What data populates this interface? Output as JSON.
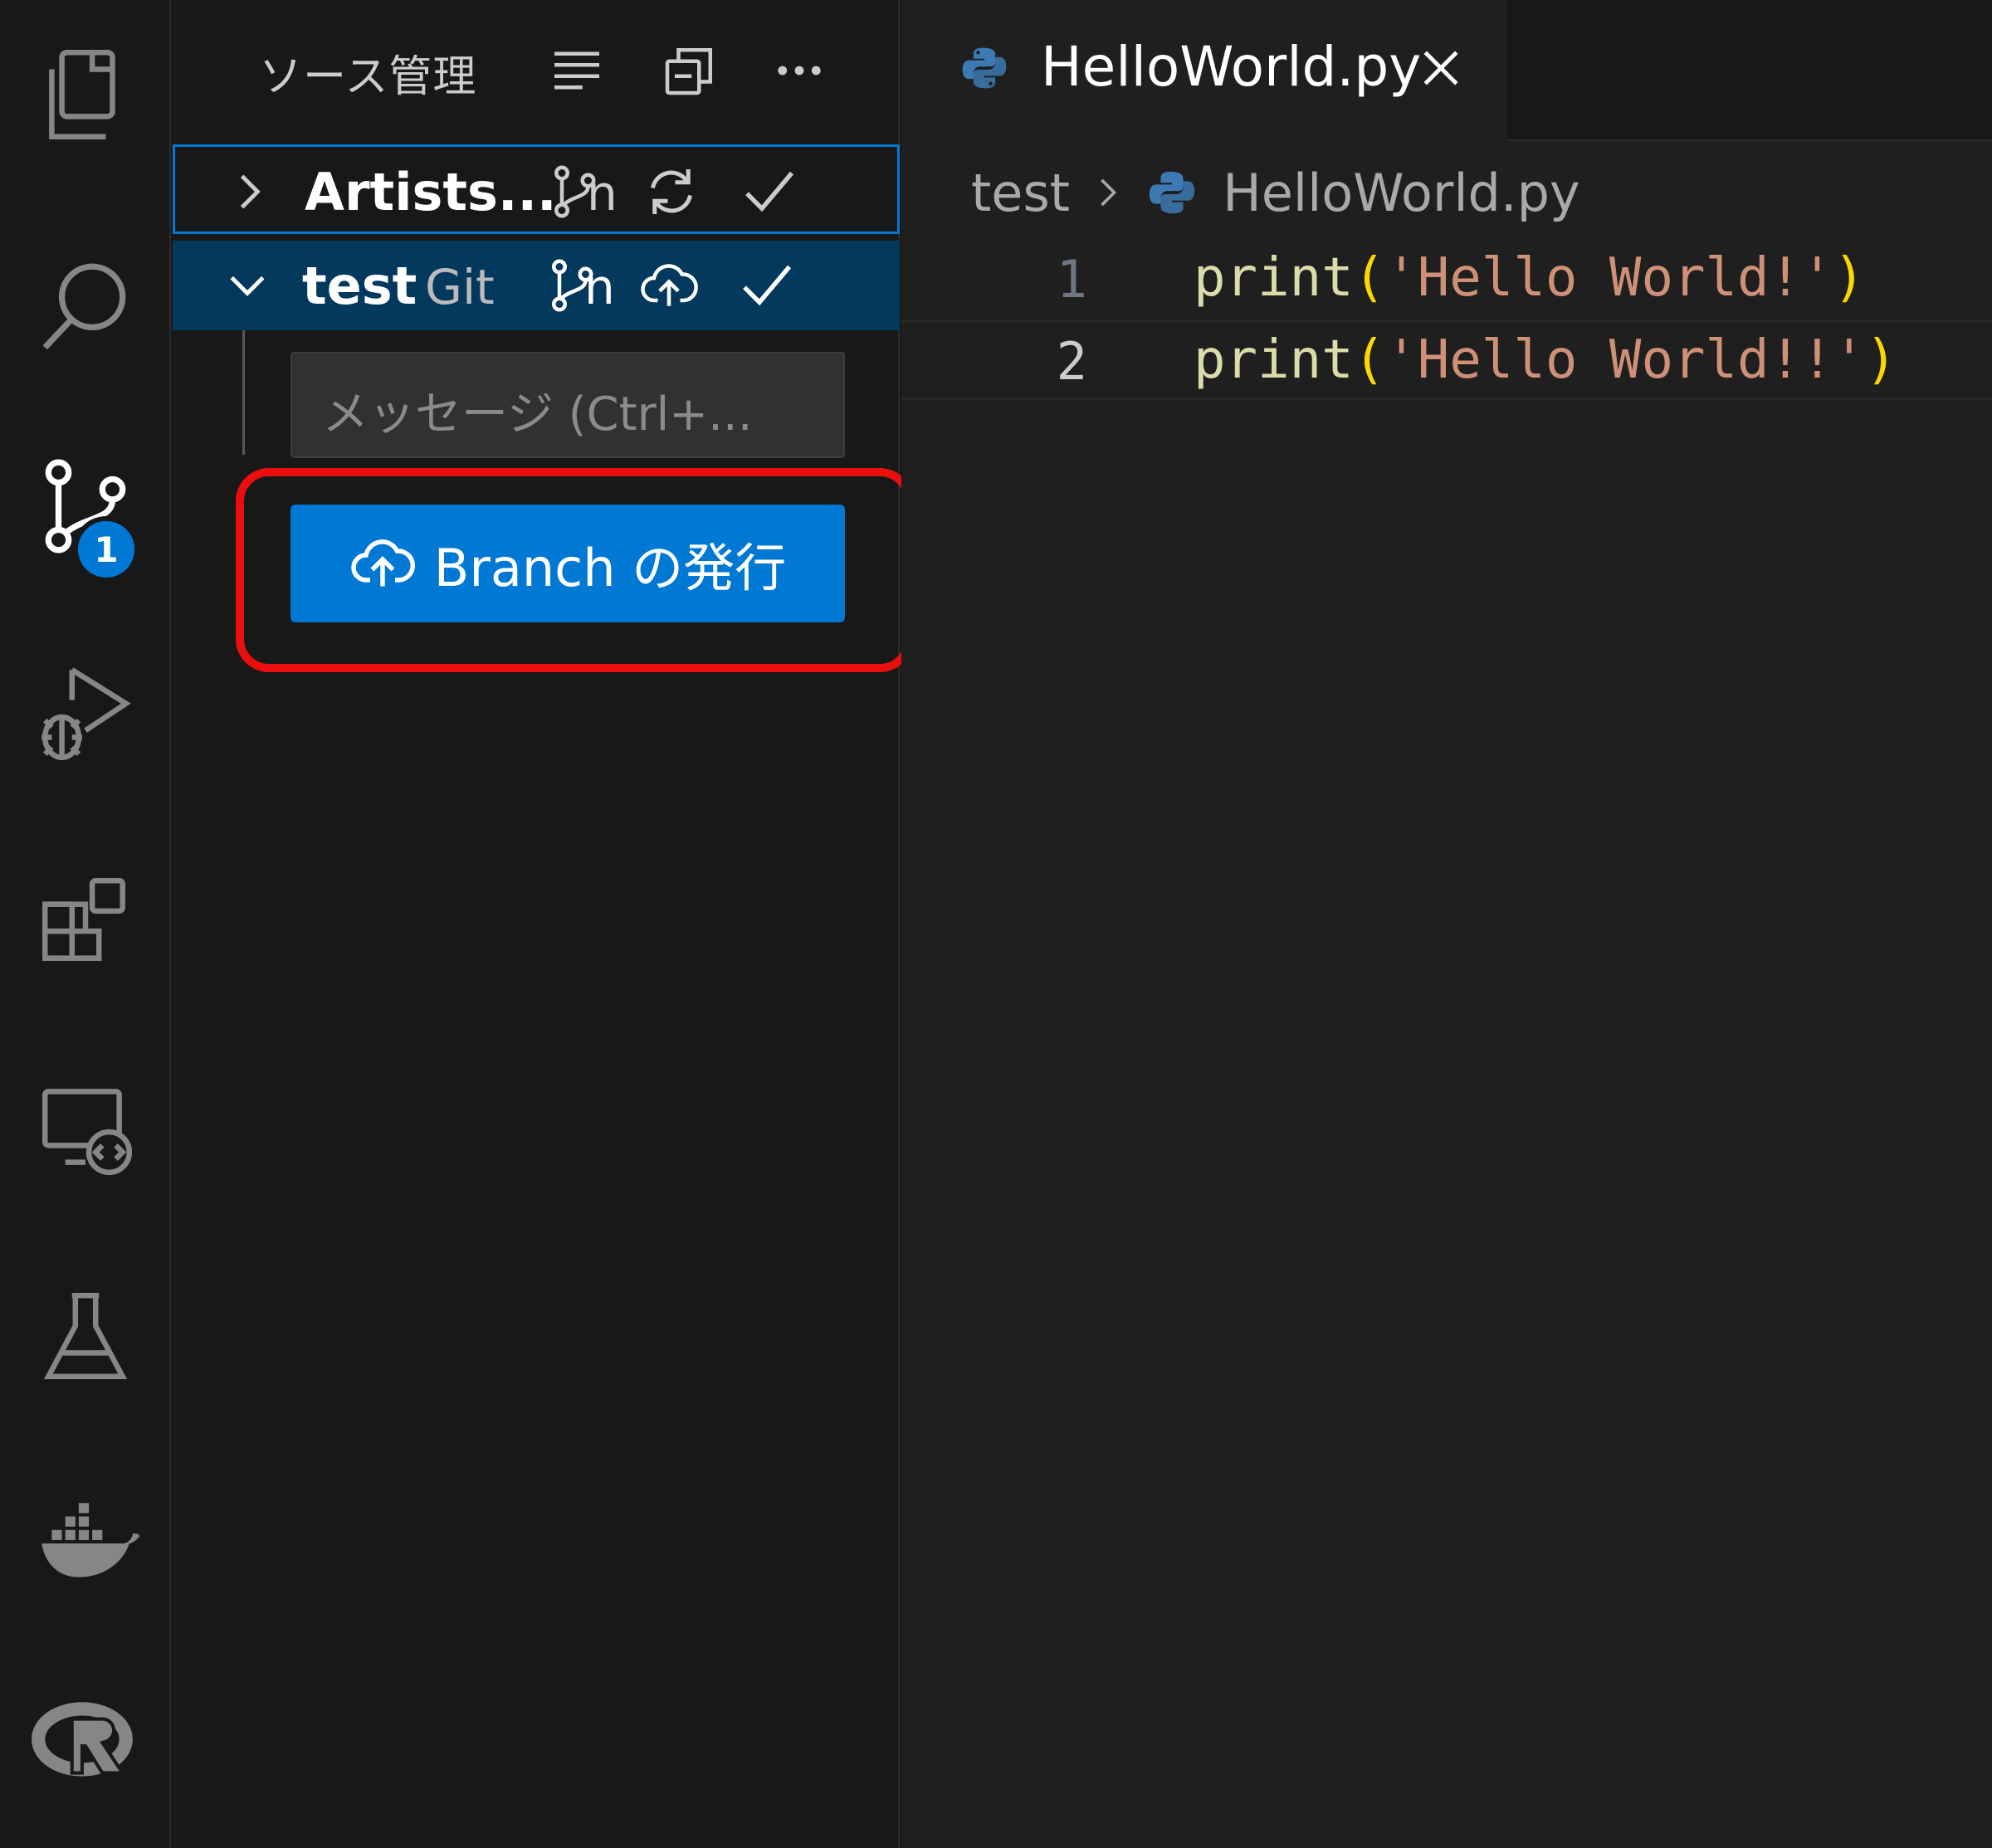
{
  "sidebar": {
    "title": "ソース管理",
    "repositories": [
      {
        "name": "Artists...",
        "provider": "",
        "branch_label": "n",
        "expanded": false
      },
      {
        "name": "test",
        "provider": "Git",
        "branch_label": "n",
        "expanded": true
      }
    ],
    "commit_input": {
      "placeholder": "メッセージ (Ctrl+..."
    },
    "publish_button": {
      "label": "Branch の発行"
    }
  },
  "activity_bar": {
    "items": [
      "explorer-icon",
      "search-icon",
      "source-control-icon",
      "run-debug-icon",
      "extensions-icon",
      "remote-explorer-icon",
      "testing-icon",
      "docker-icon",
      "r-icon"
    ],
    "source_control_badge": "1"
  },
  "editor": {
    "tab": {
      "label": "HelloWorld.py"
    },
    "breadcrumb": {
      "folder": "test",
      "file": "HelloWorld.py"
    },
    "lines": [
      {
        "number": "1",
        "fn": "print",
        "open": "(",
        "str": "'Hello World!'",
        "close": ")"
      },
      {
        "number": "2",
        "fn": "print",
        "open": "(",
        "str": "'Hello World!!'",
        "close": ")"
      }
    ]
  },
  "colors": {
    "accent": "#0078d4",
    "highlight_frame": "#ea0e0e",
    "selected_row": "#04395e"
  }
}
